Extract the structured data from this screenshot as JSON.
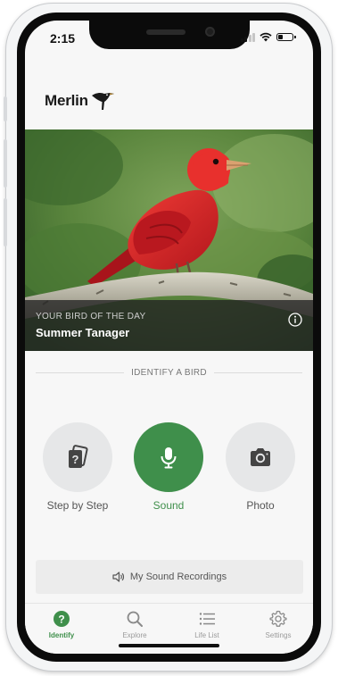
{
  "status_bar": {
    "time": "2:15",
    "battery_level": 0.35
  },
  "app": {
    "logo_text": "Merlin"
  },
  "bird_of_day": {
    "kicker": "YOUR BIRD OF THE DAY",
    "name": "Summer Tanager"
  },
  "identify": {
    "heading": "IDENTIFY A BIRD",
    "options": [
      {
        "label": "Step by Step",
        "icon": "question-cards-icon",
        "active": false
      },
      {
        "label": "Sound",
        "icon": "microphone-icon",
        "active": true
      },
      {
        "label": "Photo",
        "icon": "camera-icon",
        "active": false
      }
    ]
  },
  "recordings": {
    "label": "My Sound Recordings",
    "icon": "speaker-icon"
  },
  "tabs": [
    {
      "label": "Identify",
      "icon": "question-circle-icon",
      "active": true
    },
    {
      "label": "Explore",
      "icon": "search-icon",
      "active": false
    },
    {
      "label": "Life List",
      "icon": "list-icon",
      "active": false
    },
    {
      "label": "Settings",
      "icon": "gear-icon",
      "active": false
    }
  ],
  "colors": {
    "accent_green": "#3f8f4b",
    "tanager_red": "#d7262a",
    "button_gray": "#e6e7e8"
  }
}
